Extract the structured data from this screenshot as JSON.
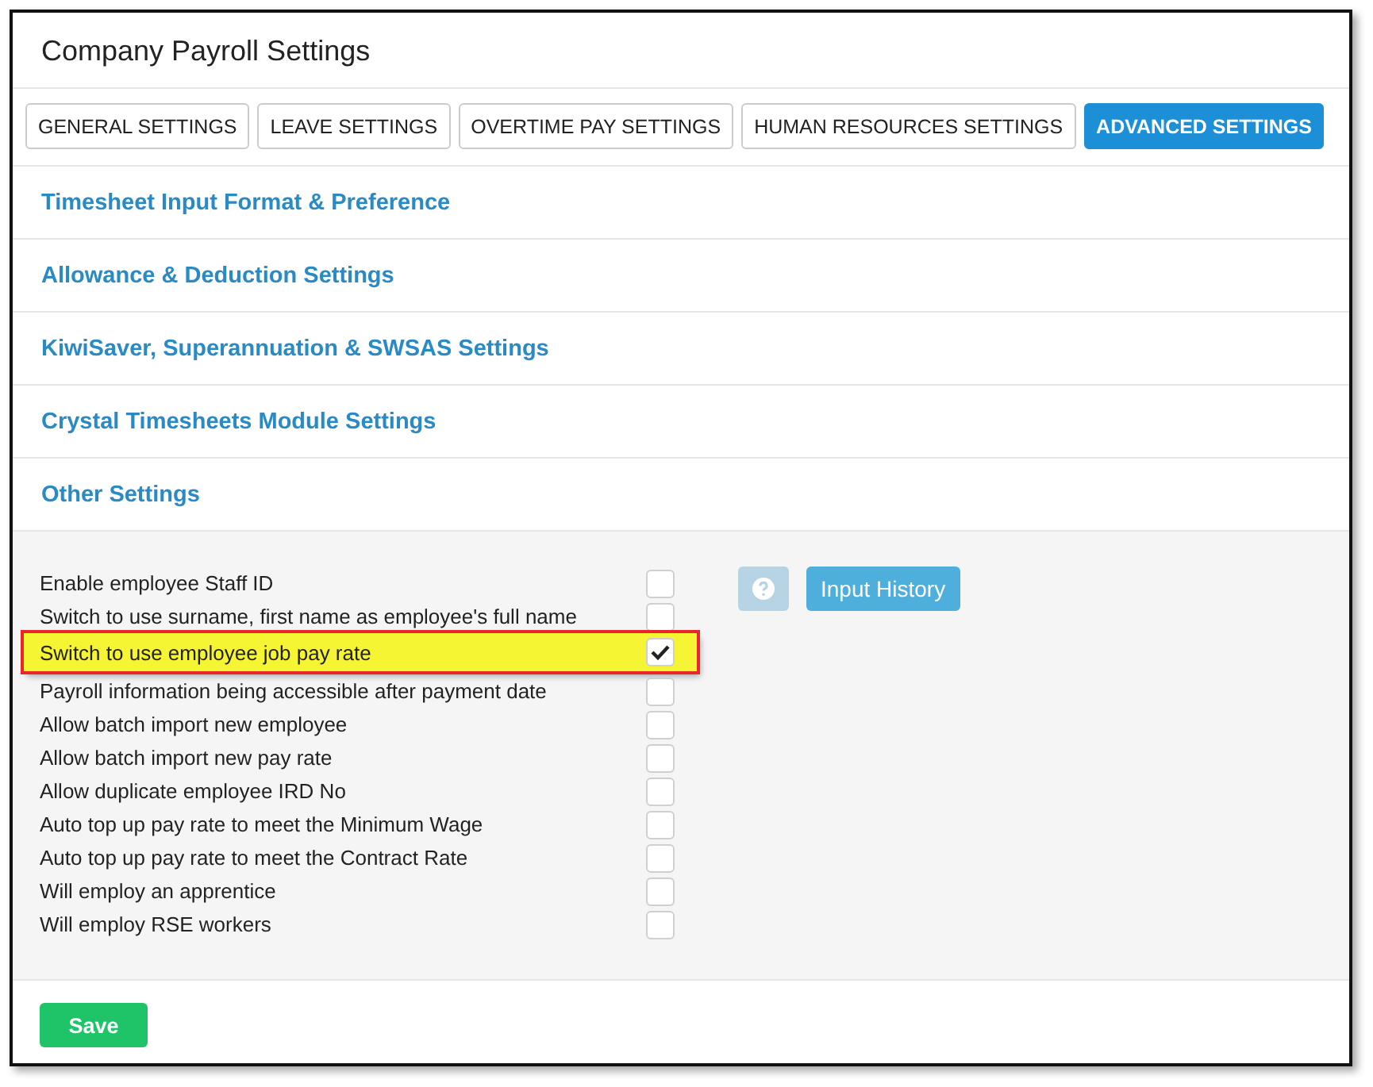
{
  "title": "Company Payroll Settings",
  "tabs": [
    {
      "label": "GENERAL SETTINGS",
      "selected": false
    },
    {
      "label": "LEAVE SETTINGS",
      "selected": false
    },
    {
      "label": "OVERTIME PAY SETTINGS",
      "selected": false
    },
    {
      "label": "HUMAN RESOURCES SETTINGS",
      "selected": false
    },
    {
      "label": "ADVANCED SETTINGS",
      "selected": true
    }
  ],
  "sections": [
    {
      "title": "Timesheet Input Format & Preference"
    },
    {
      "title": "Allowance & Deduction Settings"
    },
    {
      "title": "KiwiSaver, Superannuation & SWSAS Settings"
    },
    {
      "title": "Crystal Timesheets Module Settings"
    },
    {
      "title": "Other Settings"
    }
  ],
  "options": [
    {
      "label": "Enable employee Staff ID",
      "checked": false,
      "highlighted": false
    },
    {
      "label": "Switch to use surname, first name as employee's full name",
      "checked": false,
      "highlighted": false
    },
    {
      "label": "Switch to use employee job pay rate",
      "checked": true,
      "highlighted": true
    },
    {
      "label": "Payroll information being accessible after payment date",
      "checked": false,
      "highlighted": false
    },
    {
      "label": "Allow batch import new employee",
      "checked": false,
      "highlighted": false
    },
    {
      "label": "Allow batch import new pay rate",
      "checked": false,
      "highlighted": false
    },
    {
      "label": "Allow duplicate employee IRD No",
      "checked": false,
      "highlighted": false
    },
    {
      "label": "Auto top up pay rate to meet the Minimum Wage",
      "checked": false,
      "highlighted": false
    },
    {
      "label": "Auto top up pay rate to meet the Contract Rate",
      "checked": false,
      "highlighted": false
    },
    {
      "label": "Will employ an apprentice",
      "checked": false,
      "highlighted": false
    },
    {
      "label": "Will employ RSE workers",
      "checked": false,
      "highlighted": false
    }
  ],
  "input_history_button": "Input History",
  "save_button": "Save"
}
